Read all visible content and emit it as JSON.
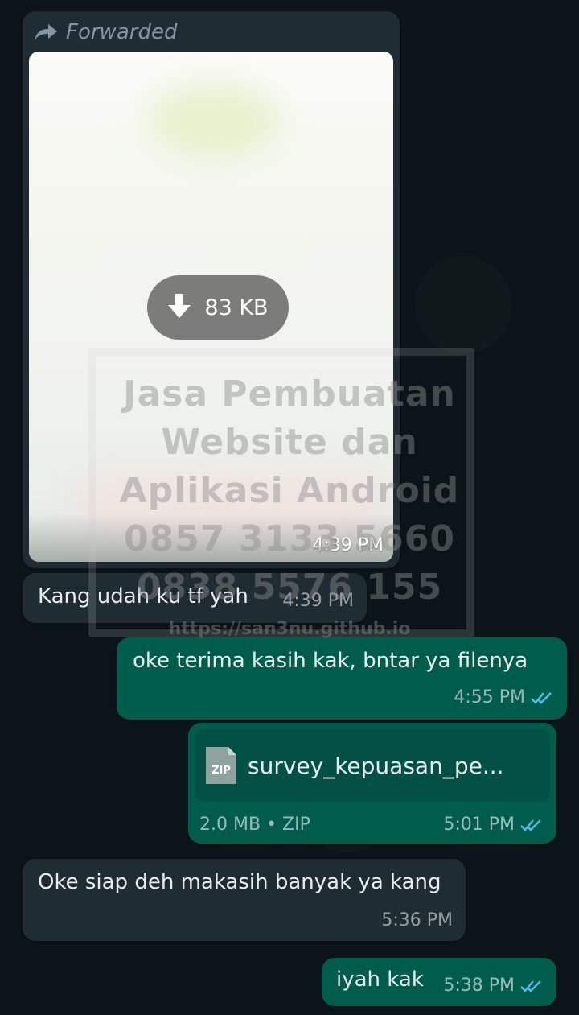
{
  "forwarded_image": {
    "forwarded_label": "Forwarded",
    "download_size": "83 KB",
    "time": "4:39 PM"
  },
  "watermark": {
    "lines": [
      "Jasa Pembuatan",
      "Website dan",
      "Aplikasi Android",
      "0857 3133 5660",
      "0838 5576 155"
    ],
    "url": "https://san3nu.github.io"
  },
  "messages": [
    {
      "direction": "incoming",
      "text": "Kang udah ku tf yah",
      "time": "4:39 PM"
    },
    {
      "direction": "outgoing",
      "text": "oke terima kasih kak, bntar ya filenya",
      "time": "4:55 PM",
      "status": "read"
    },
    {
      "direction": "outgoing",
      "type": "file",
      "file_name": "survey_kepuasan_pe...",
      "file_icon_text": "ZIP",
      "file_info": "2.0 MB • ZIP",
      "time": "5:01 PM",
      "status": "read"
    },
    {
      "direction": "incoming",
      "text": "Oke siap deh makasih banyak ya kang",
      "time": "5:36 PM"
    },
    {
      "direction": "outgoing",
      "text": "iyah kak",
      "time": "5:38 PM",
      "status": "read"
    }
  ],
  "colors": {
    "background": "#0b1418",
    "incoming_bubble": "#1f2c34",
    "outgoing_bubble": "#005c4b",
    "read_ticks": "#53bdeb"
  }
}
